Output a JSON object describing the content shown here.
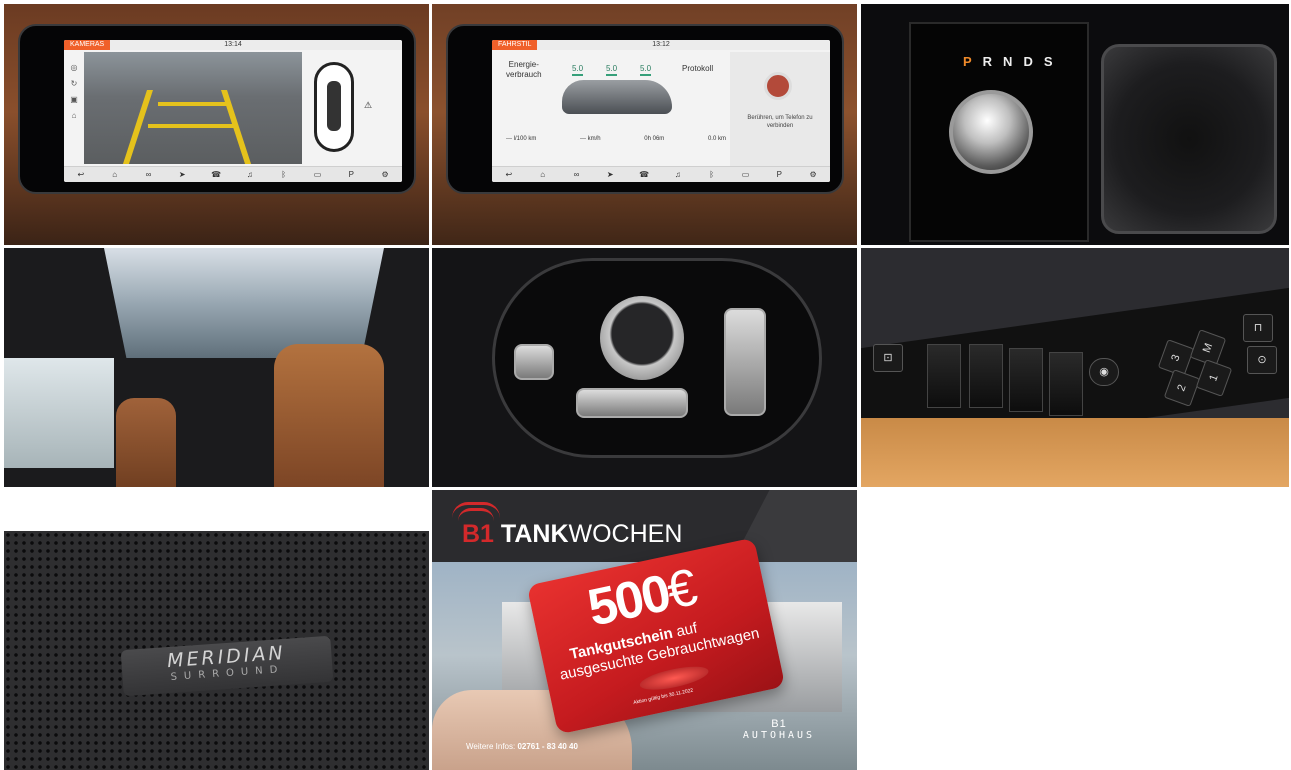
{
  "screen1": {
    "tag": "KAMERAS",
    "time": "13:14",
    "dock_icons": [
      "back-icon",
      "home-icon",
      "link-icon",
      "navigation-icon",
      "phone-icon",
      "media-icon",
      "bluetooth-icon",
      "camera-icon",
      "parking-icon",
      "settings-icon"
    ]
  },
  "screen2": {
    "tag": "FAHRSTIL",
    "time": "13:12",
    "energy_label_1": "Energie-",
    "energy_label_2": "verbrauch",
    "scores": [
      "5.0",
      "5.0",
      "5.0"
    ],
    "protokoll": "Protokoll",
    "stats": [
      "--- l/100 km",
      "--- km/h",
      "0h 06m",
      "0.0 km"
    ],
    "phone_hint": "Berühren, um Telefon zu verbinden"
  },
  "gear": {
    "p": "P",
    "rest": "RNDS"
  },
  "speaker": {
    "brand": "MERIDIAN",
    "sub": "SURROUND"
  },
  "window_switches": {
    "memory_m": "M",
    "memory_1": "1",
    "memory_2": "2",
    "memory_3": "3"
  },
  "ad": {
    "b1": "B1",
    "tank": "TANK",
    "wochen": "WOCHEN",
    "amount": "500",
    "currency": "€",
    "line1_bold": "Tankgutschein",
    "line1_rest": " auf",
    "line2": "ausgesuchte Gebrauchtwagen",
    "fine": "Aktion gültig bis 30.11.2022",
    "info_label": "Weitere Infos: ",
    "phone": "02761 - 83 40 40",
    "brand_b1": "B1",
    "brand_name": "AUTOHAUS"
  },
  "colors": {
    "accent_red": "#d3292b",
    "screen_tab_orange": "#f0602a",
    "leather_tan": "#c98a47"
  }
}
